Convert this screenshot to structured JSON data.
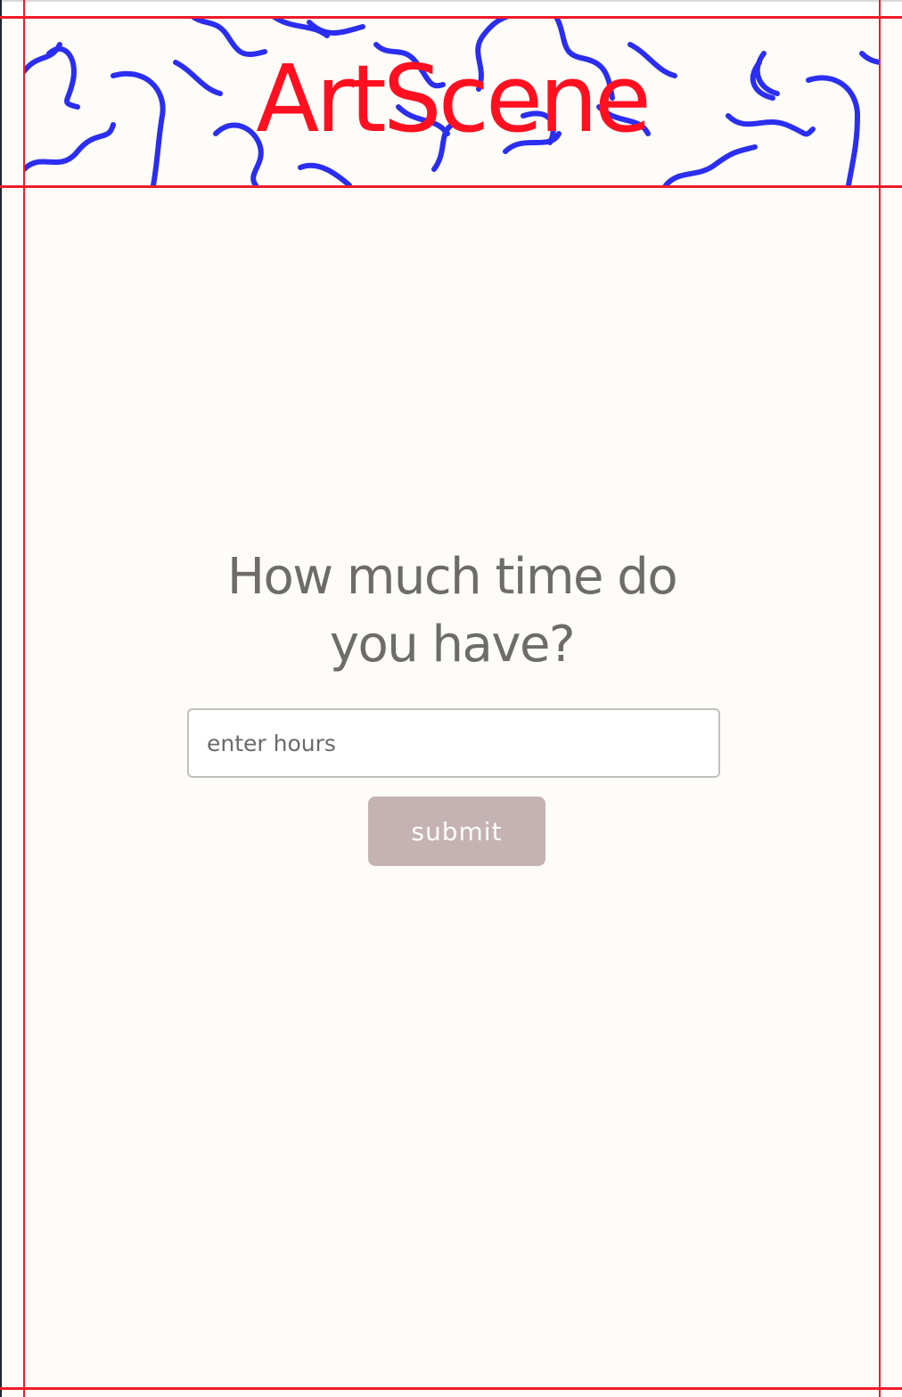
{
  "header": {
    "logo_text": "ArtScene",
    "logo_color": "#ff1020",
    "pattern_color": "#2b2ef0"
  },
  "main": {
    "question": "How much time do you have?",
    "hours_input": {
      "value": "",
      "placeholder": "enter hours"
    },
    "submit_label": "submit",
    "submit_color": "#c4b3b2"
  },
  "layout_guides": {
    "color": "#ee1c2a"
  }
}
